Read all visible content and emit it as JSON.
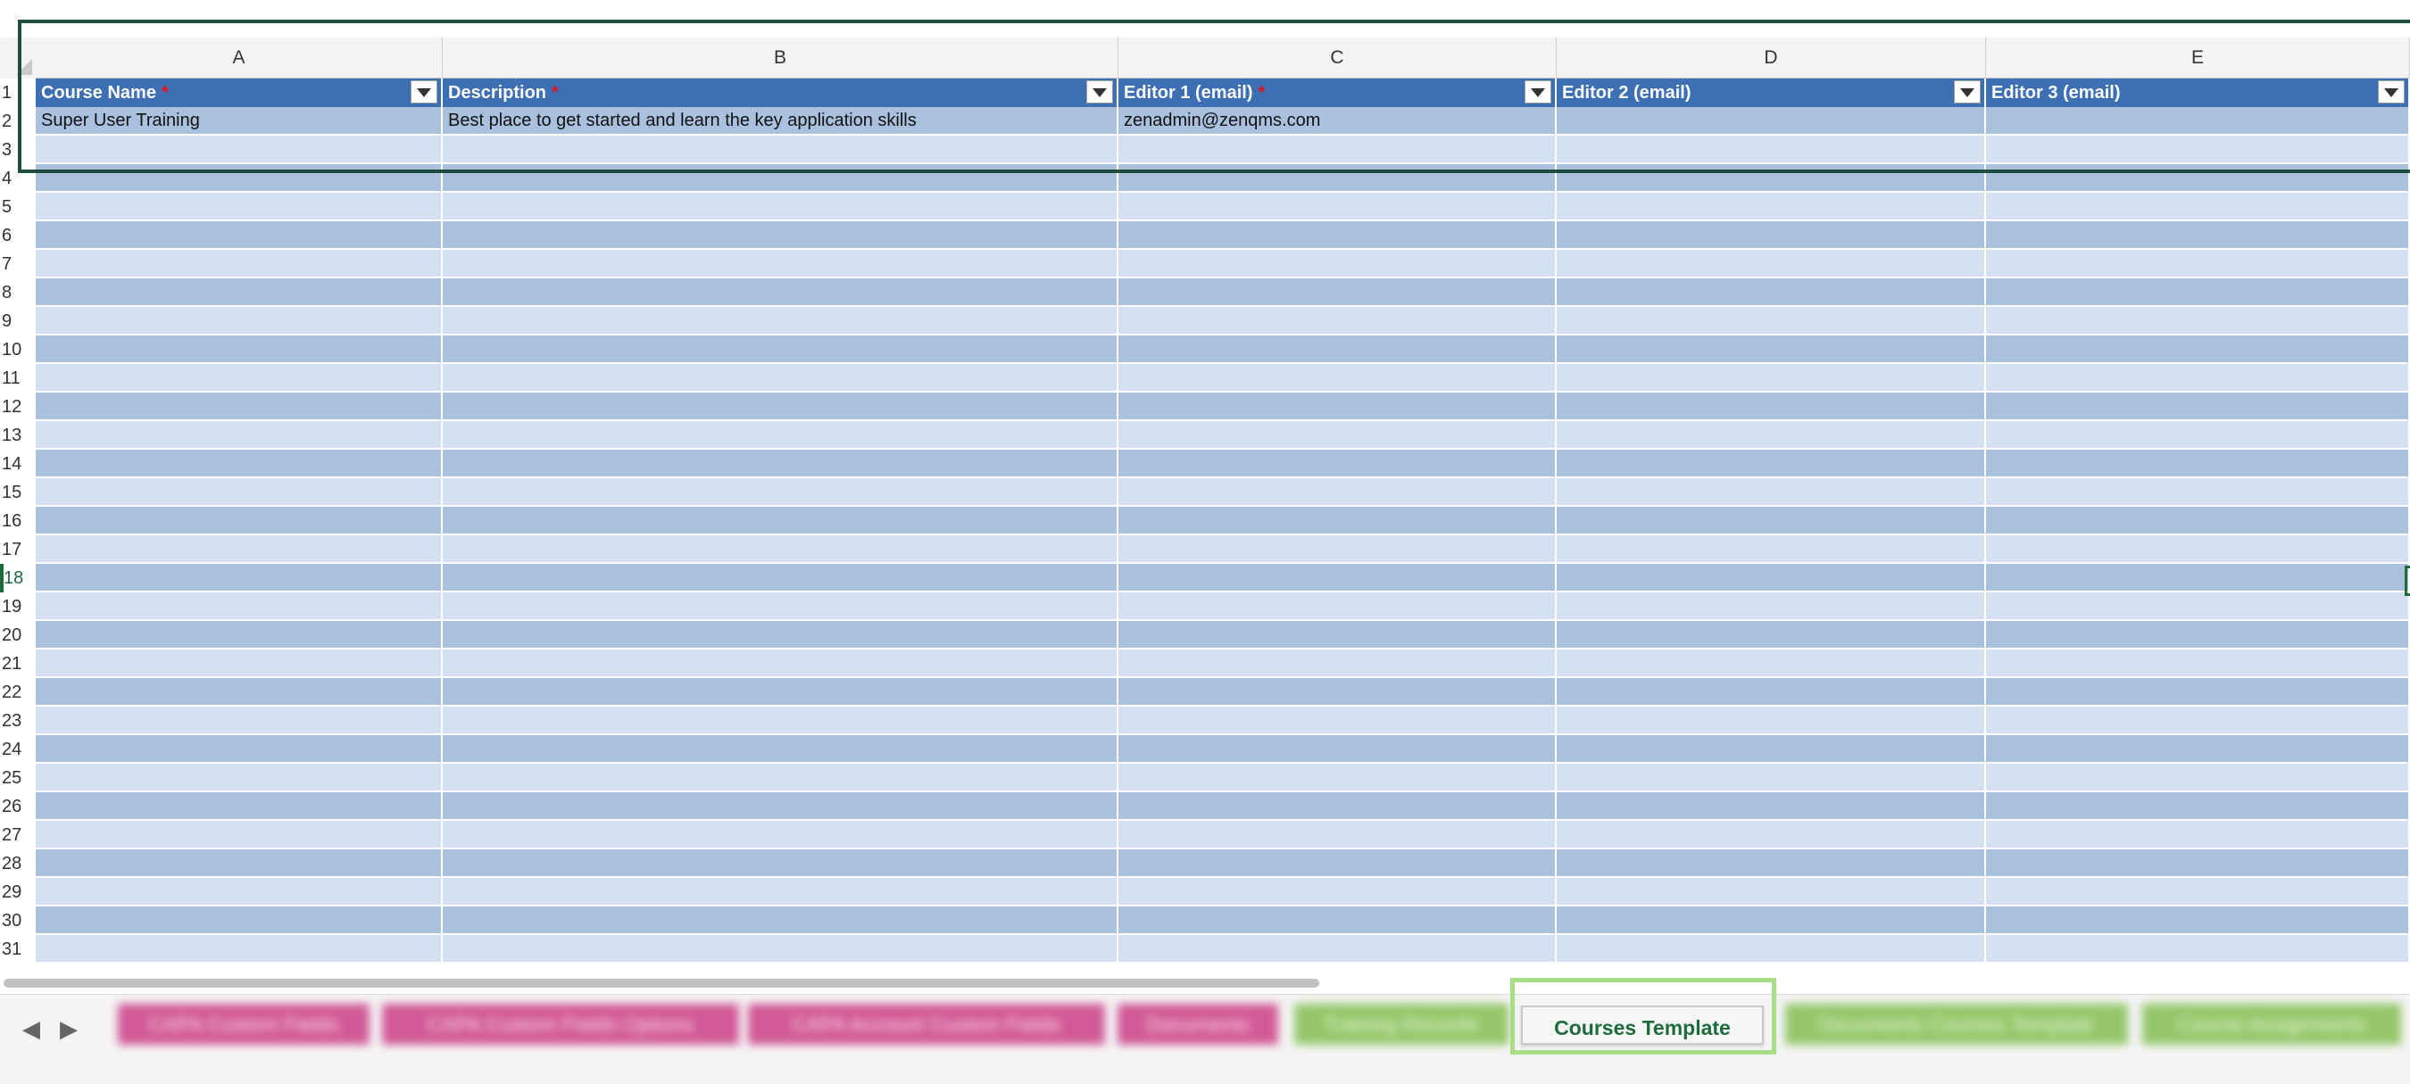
{
  "columns": [
    {
      "letter": "A"
    },
    {
      "letter": "B"
    },
    {
      "letter": "C"
    },
    {
      "letter": "D"
    },
    {
      "letter": "E"
    }
  ],
  "header_row": {
    "row_number": "1",
    "cells": [
      {
        "label": "Course Name",
        "required_mark": "*"
      },
      {
        "label": "Description",
        "required_mark": "*"
      },
      {
        "label": "Editor 1 (email)",
        "required_mark": "*"
      },
      {
        "label": "Editor 2 (email)",
        "required_mark": ""
      },
      {
        "label": "Editor 3 (email)",
        "required_mark": ""
      }
    ]
  },
  "data_rows": [
    {
      "row_number": "2",
      "values": [
        "Super User Training",
        "Best place to get started and learn the key application skills",
        "zenadmin@zenqms.com",
        "",
        ""
      ]
    },
    {
      "row_number": "3",
      "values": [
        "",
        "",
        "",
        "",
        ""
      ]
    },
    {
      "row_number": "4",
      "values": [
        "",
        "",
        "",
        "",
        ""
      ]
    },
    {
      "row_number": "5",
      "values": [
        "",
        "",
        "",
        "",
        ""
      ]
    },
    {
      "row_number": "6",
      "values": [
        "",
        "",
        "",
        "",
        ""
      ]
    },
    {
      "row_number": "7",
      "values": [
        "",
        "",
        "",
        "",
        ""
      ]
    },
    {
      "row_number": "8",
      "values": [
        "",
        "",
        "",
        "",
        ""
      ]
    },
    {
      "row_number": "9",
      "values": [
        "",
        "",
        "",
        "",
        ""
      ]
    },
    {
      "row_number": "10",
      "values": [
        "",
        "",
        "",
        "",
        ""
      ]
    },
    {
      "row_number": "11",
      "values": [
        "",
        "",
        "",
        "",
        ""
      ]
    },
    {
      "row_number": "12",
      "values": [
        "",
        "",
        "",
        "",
        ""
      ]
    },
    {
      "row_number": "13",
      "values": [
        "",
        "",
        "",
        "",
        ""
      ]
    },
    {
      "row_number": "14",
      "values": [
        "",
        "",
        "",
        "",
        ""
      ]
    },
    {
      "row_number": "15",
      "values": [
        "",
        "",
        "",
        "",
        ""
      ]
    },
    {
      "row_number": "16",
      "values": [
        "",
        "",
        "",
        "",
        ""
      ]
    },
    {
      "row_number": "17",
      "values": [
        "",
        "",
        "",
        "",
        ""
      ]
    },
    {
      "row_number": "18",
      "values": [
        "",
        "",
        "",
        "",
        ""
      ]
    },
    {
      "row_number": "19",
      "values": [
        "",
        "",
        "",
        "",
        ""
      ]
    },
    {
      "row_number": "20",
      "values": [
        "",
        "",
        "",
        "",
        ""
      ]
    },
    {
      "row_number": "21",
      "values": [
        "",
        "",
        "",
        "",
        ""
      ]
    },
    {
      "row_number": "22",
      "values": [
        "",
        "",
        "",
        "",
        ""
      ]
    },
    {
      "row_number": "23",
      "values": [
        "",
        "",
        "",
        "",
        ""
      ]
    },
    {
      "row_number": "24",
      "values": [
        "",
        "",
        "",
        "",
        ""
      ]
    },
    {
      "row_number": "25",
      "values": [
        "",
        "",
        "",
        "",
        ""
      ]
    },
    {
      "row_number": "26",
      "values": [
        "",
        "",
        "",
        "",
        ""
      ]
    },
    {
      "row_number": "27",
      "values": [
        "",
        "",
        "",
        "",
        ""
      ]
    },
    {
      "row_number": "28",
      "values": [
        "",
        "",
        "",
        "",
        ""
      ]
    },
    {
      "row_number": "29",
      "values": [
        "",
        "",
        "",
        "",
        ""
      ]
    },
    {
      "row_number": "30",
      "values": [
        "",
        "",
        "",
        "",
        ""
      ]
    },
    {
      "row_number": "31",
      "values": [
        "",
        "",
        "",
        "",
        ""
      ]
    }
  ],
  "active_row": "18",
  "sheet_tabs": {
    "prev_icon": "chevron-left-icon",
    "next_icon": "chevron-right-icon",
    "tabs": [
      {
        "label": "CAPA Custom Fields",
        "style": "blurred",
        "color": "#cc3f86"
      },
      {
        "label": "CAPA Custom Fields Options",
        "style": "blurred",
        "color": "#cc3f86"
      },
      {
        "label": "CAPA Account Custom Fields",
        "style": "blurred",
        "color": "#cc3f86"
      },
      {
        "label": "Documents",
        "style": "blurred",
        "color": "#cc3f86"
      },
      {
        "label": "Training Records",
        "style": "blurred",
        "color": "#8ac25a"
      },
      {
        "label": "Courses Template",
        "style": "active",
        "color": "#1e6b3c"
      },
      {
        "label": "Documents Courses Template",
        "style": "blurred",
        "color": "#8ac25a"
      },
      {
        "label": "Course Assignments",
        "style": "blurred",
        "color": "#8ac25a"
      }
    ]
  },
  "colors": {
    "header_fill": "#3d6fb5",
    "band_dark": "#a9c1df",
    "band_light": "#d5e0f0",
    "required_mark": "#e8141c",
    "selection_border": "#1f4d3e",
    "tab_highlight": "#a9dd88"
  }
}
